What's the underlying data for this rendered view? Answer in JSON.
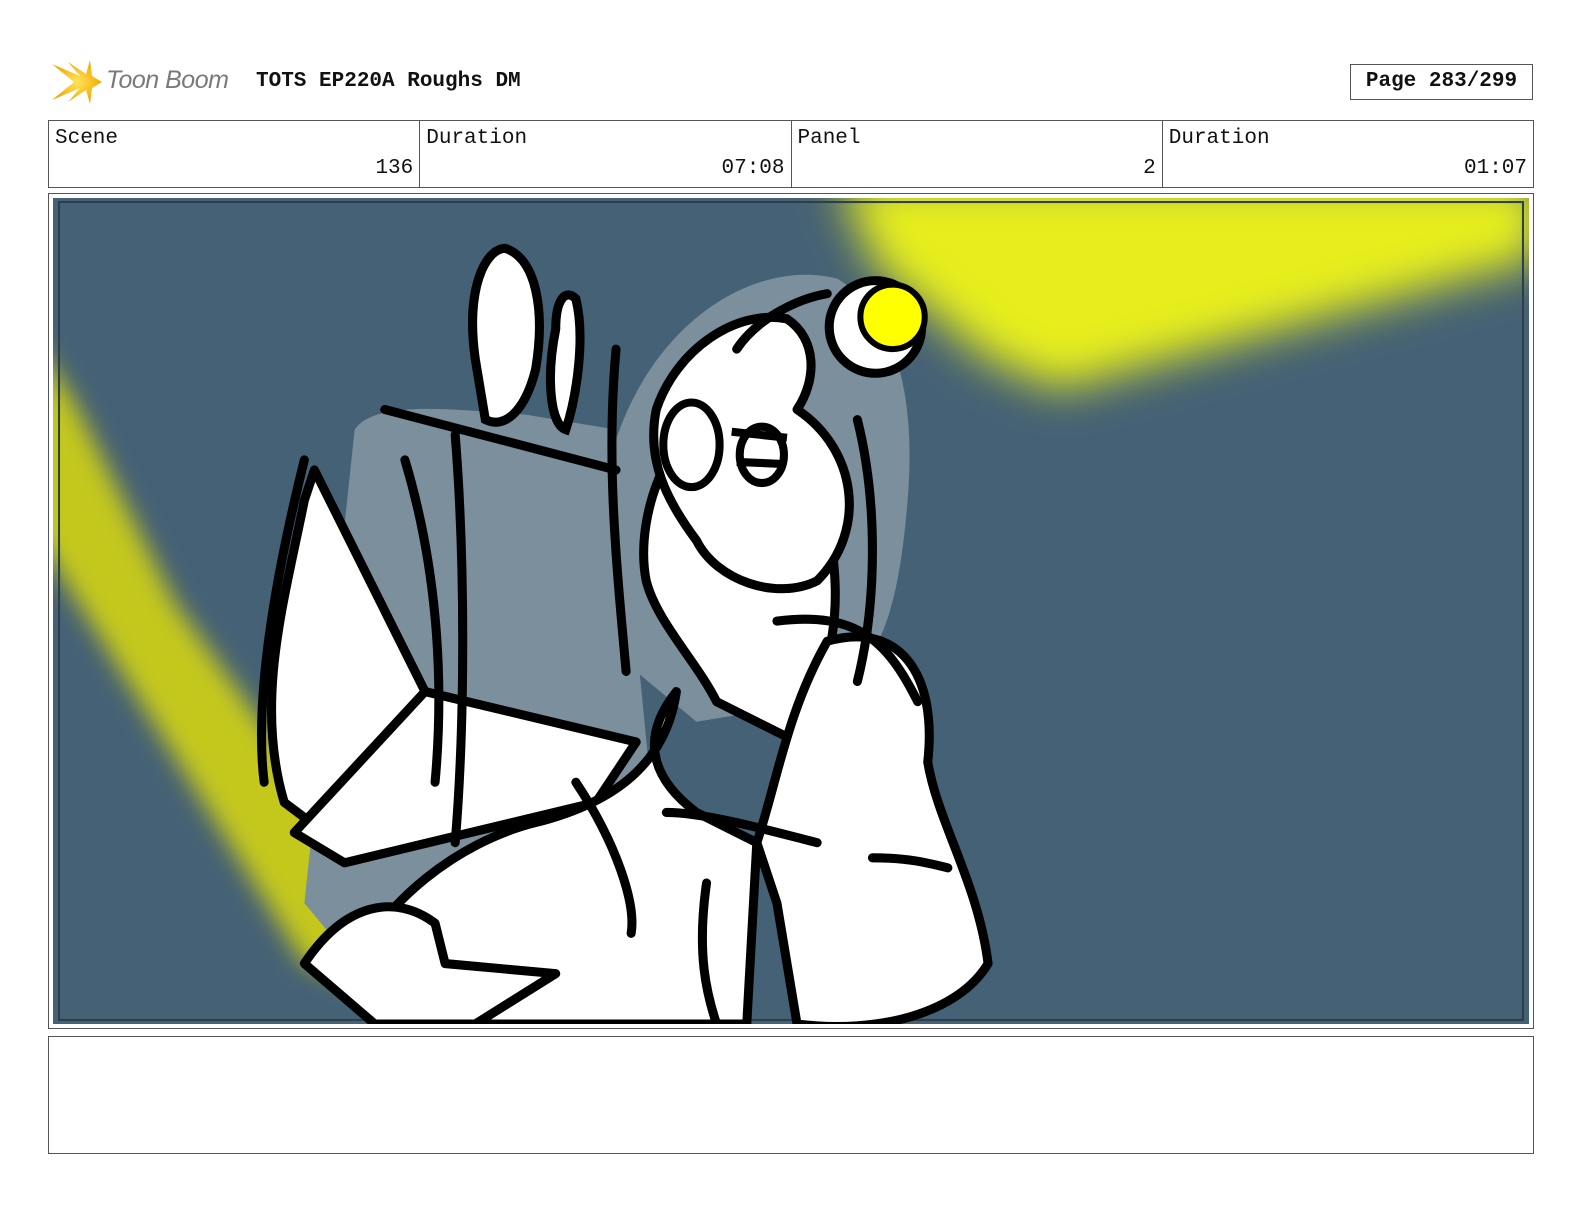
{
  "header": {
    "brand": "Toon Boom",
    "title": "TOTS EP220A Roughs DM",
    "page": "Page 283/299"
  },
  "info": {
    "scene_label": "Scene",
    "scene_value": "136",
    "duration_label": "Duration",
    "duration_value": "07:08",
    "panel_label": "Panel",
    "panel_value": "2",
    "panel_duration_label": "Duration",
    "panel_duration_value": "01:07"
  },
  "notes": {
    "text": ""
  },
  "colors": {
    "background": "#456175",
    "spotlight": "#e6ee1a",
    "helmet": "#7b8f9c",
    "light_bulb": "#ffff00"
  }
}
